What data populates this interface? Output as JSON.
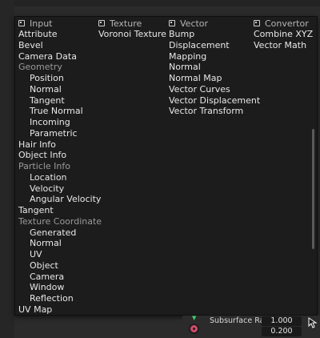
{
  "columns": [
    {
      "header": "Input",
      "icon": "input-node-icon",
      "items": [
        {
          "label": "Attribute",
          "sub": false,
          "dim": false
        },
        {
          "label": "Bevel",
          "sub": false,
          "dim": false
        },
        {
          "label": "Camera Data",
          "sub": false,
          "dim": false
        },
        {
          "label": "Geometry",
          "sub": false,
          "dim": true
        },
        {
          "label": "Position",
          "sub": true,
          "dim": false
        },
        {
          "label": "Normal",
          "sub": true,
          "dim": false
        },
        {
          "label": "Tangent",
          "sub": true,
          "dim": false
        },
        {
          "label": "True Normal",
          "sub": true,
          "dim": false
        },
        {
          "label": "Incoming",
          "sub": true,
          "dim": false
        },
        {
          "label": "Parametric",
          "sub": true,
          "dim": false
        },
        {
          "label": "Hair Info",
          "sub": false,
          "dim": false
        },
        {
          "label": "Object Info",
          "sub": false,
          "dim": false
        },
        {
          "label": "Particle Info",
          "sub": false,
          "dim": true
        },
        {
          "label": "Location",
          "sub": true,
          "dim": false
        },
        {
          "label": "Velocity",
          "sub": true,
          "dim": false
        },
        {
          "label": "Angular Velocity",
          "sub": true,
          "dim": false
        },
        {
          "label": "Tangent",
          "sub": false,
          "dim": false
        },
        {
          "label": "Texture Coordinate",
          "sub": false,
          "dim": true
        },
        {
          "label": "Generated",
          "sub": true,
          "dim": false
        },
        {
          "label": "Normal",
          "sub": true,
          "dim": false
        },
        {
          "label": "UV",
          "sub": true,
          "dim": false
        },
        {
          "label": "Object",
          "sub": true,
          "dim": false
        },
        {
          "label": "Camera",
          "sub": true,
          "dim": false
        },
        {
          "label": "Window",
          "sub": true,
          "dim": false
        },
        {
          "label": "Reflection",
          "sub": true,
          "dim": false
        },
        {
          "label": "UV Map",
          "sub": false,
          "dim": false
        }
      ]
    },
    {
      "header": "Texture",
      "icon": "texture-node-icon",
      "items": [
        {
          "label": "Voronoi Texture",
          "sub": false,
          "dim": false
        }
      ]
    },
    {
      "header": "Vector",
      "icon": "vector-node-icon",
      "items": [
        {
          "label": "Bump",
          "sub": false,
          "dim": false
        },
        {
          "label": "Displacement",
          "sub": false,
          "dim": false
        },
        {
          "label": "Mapping",
          "sub": false,
          "dim": false
        },
        {
          "label": "Normal",
          "sub": false,
          "dim": false
        },
        {
          "label": "Normal Map",
          "sub": false,
          "dim": false
        },
        {
          "label": "Vector Curves",
          "sub": false,
          "dim": false
        },
        {
          "label": "Vector Displacement",
          "sub": false,
          "dim": false
        },
        {
          "label": "Vector Transform",
          "sub": false,
          "dim": false
        }
      ]
    },
    {
      "header": "Convertor",
      "icon": "convertor-node-icon",
      "items": [
        {
          "label": "Combine XYZ",
          "sub": false,
          "dim": false
        },
        {
          "label": "Vector Math",
          "sub": false,
          "dim": false
        }
      ]
    }
  ],
  "node_panel": {
    "property_label": "Subsurface Rad..",
    "values": [
      "1.000",
      "0.200"
    ],
    "socket_color": "#d04b6a",
    "output_socket_color": "#3ecf6e"
  }
}
